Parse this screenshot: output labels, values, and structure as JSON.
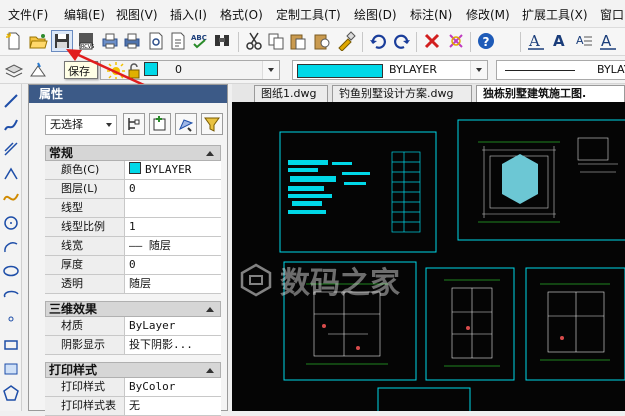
{
  "menu": [
    "文件(F)",
    "编辑(E)",
    "视图(V)",
    "插入(I)",
    "格式(O)",
    "定制工具(T)",
    "绘图(D)",
    "标注(N)",
    "修改(M)",
    "扩展工具(X)",
    "窗口"
  ],
  "toolbar": {
    "tooltip": "保存",
    "icons": [
      "new-icon",
      "open-icon",
      "save-icon",
      "recover-icon",
      "print-icon",
      "plot-icon",
      "print-preview-icon",
      "publish-icon",
      "spell-check-icon",
      "find-icon",
      "cut-icon",
      "copy-icon",
      "paste-icon",
      "match-properties-icon",
      "undo-icon",
      "redo-icon",
      "delete-icon",
      "erase-icon",
      "help-icon",
      "text-style-icon",
      "text-icon"
    ]
  },
  "layer_bar": {
    "layer_value": "0",
    "color_value": "BYLAYER",
    "linetype_value": "BYLAY"
  },
  "properties": {
    "title": "属性",
    "selection": "无选择",
    "sections": [
      {
        "name": "常规",
        "rows": [
          {
            "key": "颜色(C)",
            "value": "BYLAYER"
          },
          {
            "key": "图层(L)",
            "value": "0"
          },
          {
            "key": "线型",
            "value": ""
          },
          {
            "key": "线型比例",
            "value": "1"
          },
          {
            "key": "线宽",
            "value": "—— 随层"
          },
          {
            "key": "厚度",
            "value": "0"
          },
          {
            "key": "透明",
            "value": "随层"
          }
        ]
      },
      {
        "name": "三维效果",
        "rows": [
          {
            "key": "材质",
            "value": "ByLayer"
          },
          {
            "key": "阴影显示",
            "value": "投下阴影..."
          }
        ]
      },
      {
        "name": "打印样式",
        "rows": [
          {
            "key": "打印样式",
            "value": "ByColor"
          },
          {
            "key": "打印样式表",
            "value": "无"
          }
        ]
      }
    ]
  },
  "tabs": [
    "图纸1.dwg",
    "钓鱼别墅设计方案.dwg",
    "独栋别墅建筑施工图."
  ],
  "watermark": "数码之家",
  "colors": {
    "accent_cyan": "#00d8e8",
    "title_blue": "#3c5a87",
    "canvas_bg": "#050505",
    "arrow_red": "#e11d1d"
  }
}
